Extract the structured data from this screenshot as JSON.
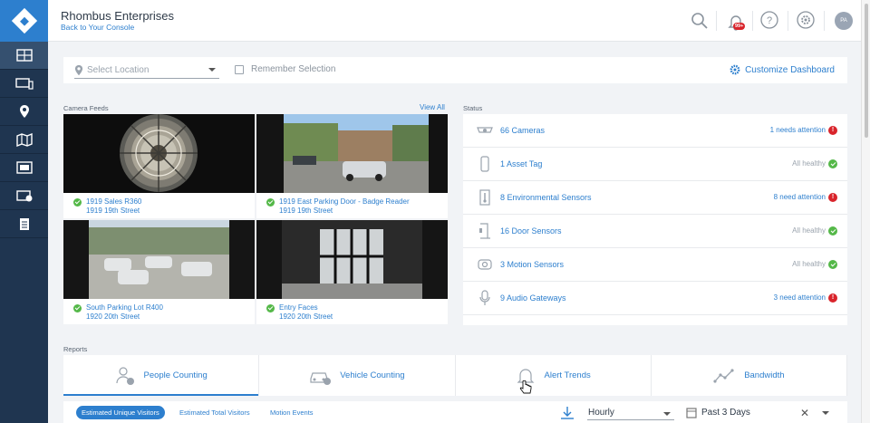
{
  "header": {
    "company": "Rhombus Enterprises",
    "back_link": "Back to Your Console",
    "notification_count": "99+",
    "avatar_initials": "PA"
  },
  "sidebar": {
    "items": [
      "dashboard-icon",
      "devices-icon",
      "location-icon",
      "map-icon",
      "video-wall-icon",
      "clips-icon",
      "logs-icon"
    ]
  },
  "filter": {
    "location_placeholder": "Select Location",
    "remember_label": "Remember Selection",
    "customize_label": "Customize Dashboard"
  },
  "camera_feeds": {
    "label": "Camera Feeds",
    "view_all": "View All",
    "feeds": [
      {
        "name": "1919 Sales R360",
        "location": "1919 19th Street"
      },
      {
        "name": "1919 East Parking Door - Badge Reader",
        "location": "1919 19th Street"
      },
      {
        "name": "South Parking Lot R400",
        "location": "1920 20th Street"
      },
      {
        "name": "Entry Faces",
        "location": "1920 20th Street"
      }
    ]
  },
  "status": {
    "label": "Status",
    "rows": [
      {
        "label": "66 Cameras",
        "state": "1 needs attention",
        "icon": "camera-icon",
        "level": "warn"
      },
      {
        "label": "1 Asset Tag",
        "state": "All healthy",
        "icon": "asset-tag-icon",
        "level": "ok"
      },
      {
        "label": "8 Environmental Sensors",
        "state": "8 need attention",
        "icon": "environmental-sensor-icon",
        "level": "warn"
      },
      {
        "label": "16 Door Sensors",
        "state": "All healthy",
        "icon": "door-sensor-icon",
        "level": "ok"
      },
      {
        "label": "3 Motion Sensors",
        "state": "All healthy",
        "icon": "motion-sensor-icon",
        "level": "ok"
      },
      {
        "label": "9 Audio Gateways",
        "state": "3 need attention",
        "icon": "audio-gateway-icon",
        "level": "warn"
      }
    ]
  },
  "reports": {
    "label": "Reports",
    "tabs": [
      {
        "label": "People Counting",
        "icon": "people-icon"
      },
      {
        "label": "Vehicle Counting",
        "icon": "vehicle-icon"
      },
      {
        "label": "Alert Trends",
        "icon": "bell-icon"
      },
      {
        "label": "Bandwidth",
        "icon": "bandwidth-icon"
      }
    ],
    "pills": [
      "Estimated Unique Visitors",
      "Estimated Total Visitors",
      "Motion Events"
    ],
    "interval": "Hourly",
    "range": "Past 3 Days"
  },
  "colors": {
    "accent": "#2d7fce",
    "sidebar": "#1f3550",
    "warn": "#d9242b",
    "ok": "#54b848"
  }
}
